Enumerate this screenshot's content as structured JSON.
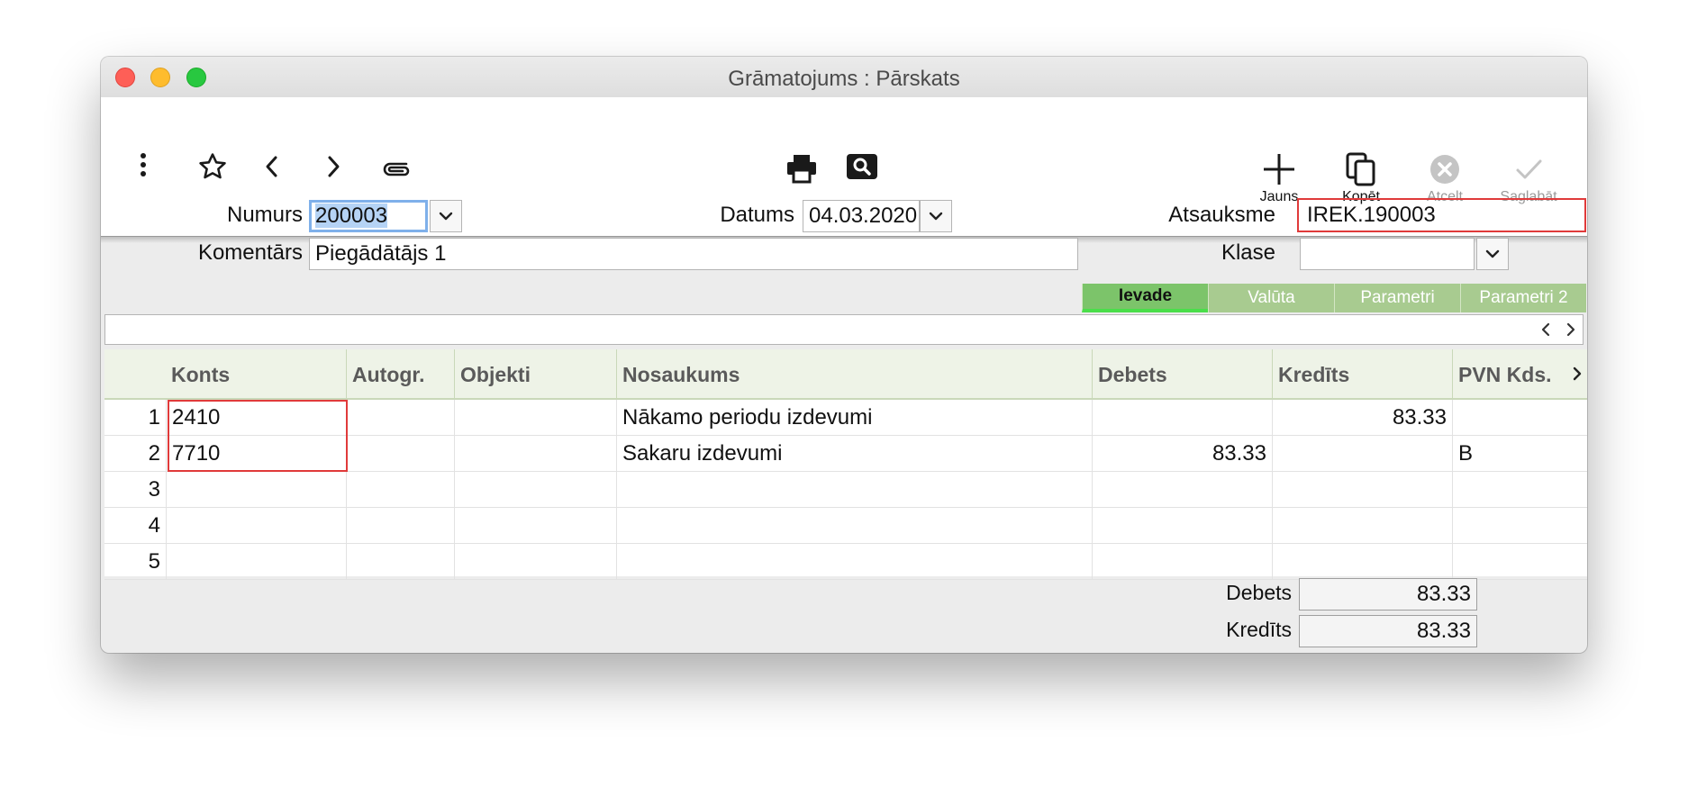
{
  "window": {
    "title": "Grāmatojums : Pārskats"
  },
  "toolbar": {
    "new_label": "Jauns",
    "copy_label": "Kopēt",
    "cancel_label": "Atcelt",
    "save_label": "Saglabāt"
  },
  "form": {
    "number_label": "Numurs",
    "number_value": "200003",
    "date_label": "Datums",
    "date_value": "04.03.2020",
    "reference_label": "Atsauksme",
    "reference_value": "IREK.190003",
    "comment_label": "Komentārs",
    "comment_value": "Piegādātājs 1",
    "class_label": "Klase",
    "class_value": ""
  },
  "tabs": [
    "Ievade",
    "Valūta",
    "Parametri",
    "Parametri 2"
  ],
  "grid": {
    "columns": [
      "Konts",
      "Autogr.",
      "Objekti",
      "Nosaukums",
      "Debets",
      "Kredīts",
      "PVN Kds."
    ],
    "rows": [
      {
        "n": "1",
        "konts": "2410",
        "autogr": "",
        "objekti": "",
        "nosaukums": "Nākamo periodu izdevumi",
        "debets": "",
        "kredits": "83.33",
        "pvn": ""
      },
      {
        "n": "2",
        "konts": "7710",
        "autogr": "",
        "objekti": "",
        "nosaukums": "Sakaru izdevumi",
        "debets": "83.33",
        "kredits": "",
        "pvn": "B"
      },
      {
        "n": "3",
        "konts": "",
        "autogr": "",
        "objekti": "",
        "nosaukums": "",
        "debets": "",
        "kredits": "",
        "pvn": ""
      },
      {
        "n": "4",
        "konts": "",
        "autogr": "",
        "objekti": "",
        "nosaukums": "",
        "debets": "",
        "kredits": "",
        "pvn": ""
      },
      {
        "n": "5",
        "konts": "",
        "autogr": "",
        "objekti": "",
        "nosaukums": "",
        "debets": "",
        "kredits": "",
        "pvn": ""
      }
    ]
  },
  "totals": {
    "debit_label": "Debets",
    "debit_value": "83.33",
    "credit_label": "Kredīts",
    "credit_value": "83.33"
  },
  "colors": {
    "highlight_border": "#e03a3a",
    "tab_active": "#7cc46a",
    "tab_inactive": "#a8cb90",
    "selection": "#b5d3f5"
  }
}
